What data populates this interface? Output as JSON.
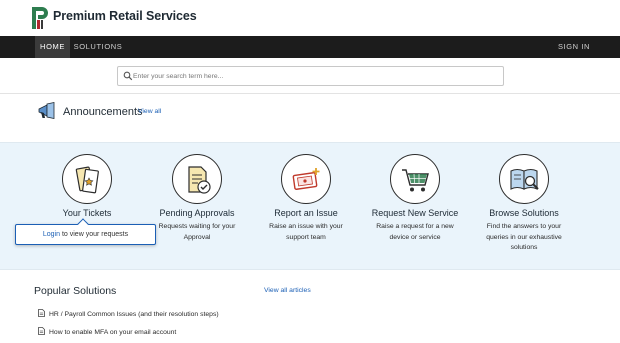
{
  "brand": {
    "name": "Premium Retail Services",
    "logo_letter": "P"
  },
  "nav": {
    "home": "HOME",
    "solutions": "SOLUTIONS",
    "sign_in": "SIGN IN"
  },
  "search": {
    "placeholder": "Enter your search term here..."
  },
  "announcements": {
    "title": "Announcements",
    "view_all": "View all"
  },
  "tiles": [
    {
      "title": "Your Tickets",
      "desc": "",
      "icon": "tickets-icon"
    },
    {
      "title": "Pending Approvals",
      "desc": "Requests waiting for your Approval",
      "icon": "approval-document-icon"
    },
    {
      "title": "Report an Issue",
      "desc": "Raise an issue with your support team",
      "icon": "issue-ticket-icon"
    },
    {
      "title": "Request New Service",
      "desc": "Raise a request for a new device or service",
      "icon": "shopping-cart-icon"
    },
    {
      "title": "Browse Solutions",
      "desc": "Find the answers to your queries in our exhaustive solutions",
      "icon": "book-search-icon"
    }
  ],
  "tooltip": {
    "login_link": "Login",
    "text": "to view your requests"
  },
  "popular": {
    "title": "Popular Solutions",
    "view_all": "View all articles",
    "items": [
      "HR / Payroll Common Issues (and their resolution steps)",
      "How to enable MFA on your email account"
    ]
  },
  "colors": {
    "nav_bg": "#1c1c1c",
    "panel_bg": "#eaf4fb",
    "link": "#1b5fb5",
    "logo_green": "#2e7d4f",
    "logo_red": "#b0282e"
  }
}
